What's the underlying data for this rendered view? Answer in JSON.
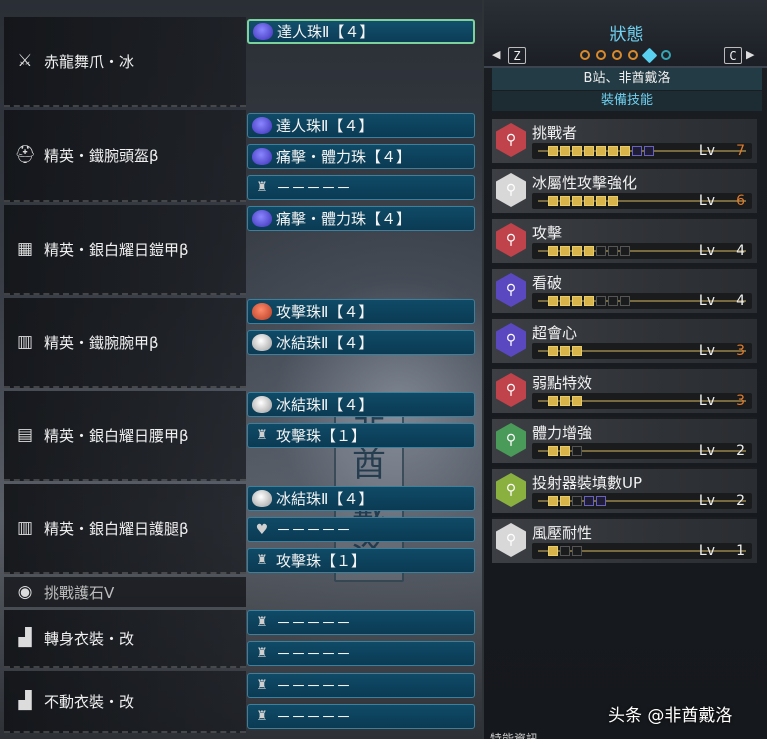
{
  "equipment": [
    {
      "name": "赤龍舞爪・冰",
      "icon": "weapon-icon",
      "decos": [
        {
          "label": "達人珠Ⅱ【４】",
          "gem": "blue",
          "selected": true
        }
      ]
    },
    {
      "name": "精英・鐵腕頭盔β",
      "icon": "helm-icon",
      "decos": [
        {
          "label": "達人珠Ⅱ【４】",
          "gem": "blue"
        },
        {
          "label": "痛擊・體力珠【４】",
          "gem": "blue"
        },
        {
          "label": "－－－－－",
          "gem": "empty"
        }
      ]
    },
    {
      "name": "精英・銀白耀日鎧甲β",
      "icon": "chest-icon",
      "decos": [
        {
          "label": "痛擊・體力珠【４】",
          "gem": "blue"
        }
      ]
    },
    {
      "name": "精英・鐵腕腕甲β",
      "icon": "arm-icon",
      "decos": [
        {
          "label": "攻擊珠Ⅱ【４】",
          "gem": "red"
        },
        {
          "label": "冰結珠Ⅱ【４】",
          "gem": "white"
        }
      ]
    },
    {
      "name": "精英・銀白耀日腰甲β",
      "icon": "waist-icon",
      "decos": [
        {
          "label": "冰結珠Ⅱ【４】",
          "gem": "white"
        },
        {
          "label": "攻擊珠【１】",
          "gem": "empty"
        }
      ]
    },
    {
      "name": "精英・銀白耀日護腿β",
      "icon": "leg-icon",
      "decos": [
        {
          "label": "冰結珠Ⅱ【４】",
          "gem": "white"
        },
        {
          "label": "－－－－－",
          "gem": "heart"
        },
        {
          "label": "攻擊珠【１】",
          "gem": "empty"
        }
      ]
    },
    {
      "name": "挑戰護石Ⅴ",
      "icon": "charm-icon",
      "decos": []
    },
    {
      "name": "轉身衣裝・改",
      "icon": "mantle-icon",
      "decos": [
        {
          "label": "－－－－－",
          "gem": "empty"
        },
        {
          "label": "－－－－－",
          "gem": "empty"
        }
      ]
    },
    {
      "name": "不動衣裝・改",
      "icon": "mantle-icon",
      "decos": [
        {
          "label": "－－－－－",
          "gem": "empty"
        },
        {
          "label": "－－－－－",
          "gem": "empty"
        }
      ]
    }
  ],
  "watermark": [
    "非",
    "酋",
    "戴",
    "洛"
  ],
  "status_panel": {
    "title": "狀態",
    "key_left": "Z",
    "key_right": "C",
    "arrow_left": "◀",
    "arrow_right": "▶",
    "set_name": "B站、非酋戴洛",
    "section": "裝備技能",
    "lv_label": "Lv",
    "skills": [
      {
        "name": "挑戰者",
        "level": "7",
        "max_base": 7,
        "ext": 2,
        "level_color": "#e07a2a",
        "icon_color": "#c0424a"
      },
      {
        "name": "冰屬性攻擊強化",
        "level": "6",
        "max_base": 6,
        "ext": 0,
        "level_color": "#e07a2a",
        "icon_color": "#d8d8d8"
      },
      {
        "name": "攻擊",
        "level": "4",
        "max_base": 7,
        "ext": 0,
        "level_color": "#eeeeee",
        "icon_color": "#c0424a"
      },
      {
        "name": "看破",
        "level": "4",
        "max_base": 7,
        "ext": 0,
        "level_color": "#eeeeee",
        "icon_color": "#5a48c0"
      },
      {
        "name": "超會心",
        "level": "3",
        "max_base": 3,
        "ext": 0,
        "level_color": "#e07a2a",
        "icon_color": "#5a48c0"
      },
      {
        "name": "弱點特效",
        "level": "3",
        "max_base": 3,
        "ext": 0,
        "level_color": "#e07a2a",
        "icon_color": "#c0424a"
      },
      {
        "name": "體力增強",
        "level": "2",
        "max_base": 3,
        "ext": 0,
        "level_color": "#eeeeee",
        "icon_color": "#4a9a5a"
      },
      {
        "name": "投射器裝填數UP",
        "level": "2",
        "max_base": 3,
        "ext": 2,
        "level_color": "#eeeeee",
        "icon_color": "#8ab040"
      },
      {
        "name": "風壓耐性",
        "level": "1",
        "max_base": 3,
        "ext": 0,
        "level_color": "#eeeeee",
        "icon_color": "#d8d8d8"
      }
    ]
  },
  "footer": "特能資訊",
  "credit": "头条 @非酋戴洛"
}
